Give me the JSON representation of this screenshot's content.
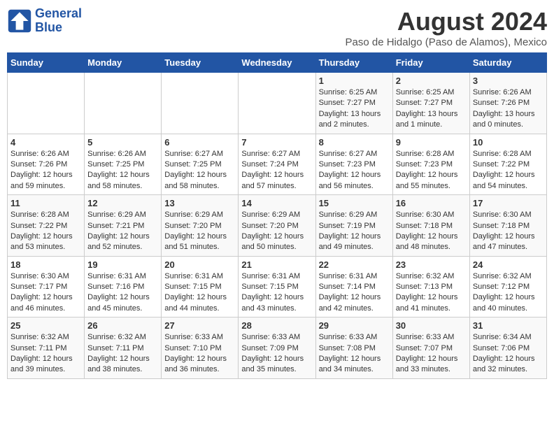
{
  "logo": {
    "line1": "General",
    "line2": "Blue"
  },
  "title": "August 2024",
  "subtitle": "Paso de Hidalgo (Paso de Alamos), Mexico",
  "days_of_week": [
    "Sunday",
    "Monday",
    "Tuesday",
    "Wednesday",
    "Thursday",
    "Friday",
    "Saturday"
  ],
  "weeks": [
    [
      {
        "day": "",
        "info": ""
      },
      {
        "day": "",
        "info": ""
      },
      {
        "day": "",
        "info": ""
      },
      {
        "day": "",
        "info": ""
      },
      {
        "day": "1",
        "info": "Sunrise: 6:25 AM\nSunset: 7:27 PM\nDaylight: 13 hours and 2 minutes."
      },
      {
        "day": "2",
        "info": "Sunrise: 6:25 AM\nSunset: 7:27 PM\nDaylight: 13 hours and 1 minute."
      },
      {
        "day": "3",
        "info": "Sunrise: 6:26 AM\nSunset: 7:26 PM\nDaylight: 13 hours and 0 minutes."
      }
    ],
    [
      {
        "day": "4",
        "info": "Sunrise: 6:26 AM\nSunset: 7:26 PM\nDaylight: 12 hours and 59 minutes."
      },
      {
        "day": "5",
        "info": "Sunrise: 6:26 AM\nSunset: 7:25 PM\nDaylight: 12 hours and 58 minutes."
      },
      {
        "day": "6",
        "info": "Sunrise: 6:27 AM\nSunset: 7:25 PM\nDaylight: 12 hours and 58 minutes."
      },
      {
        "day": "7",
        "info": "Sunrise: 6:27 AM\nSunset: 7:24 PM\nDaylight: 12 hours and 57 minutes."
      },
      {
        "day": "8",
        "info": "Sunrise: 6:27 AM\nSunset: 7:23 PM\nDaylight: 12 hours and 56 minutes."
      },
      {
        "day": "9",
        "info": "Sunrise: 6:28 AM\nSunset: 7:23 PM\nDaylight: 12 hours and 55 minutes."
      },
      {
        "day": "10",
        "info": "Sunrise: 6:28 AM\nSunset: 7:22 PM\nDaylight: 12 hours and 54 minutes."
      }
    ],
    [
      {
        "day": "11",
        "info": "Sunrise: 6:28 AM\nSunset: 7:22 PM\nDaylight: 12 hours and 53 minutes."
      },
      {
        "day": "12",
        "info": "Sunrise: 6:29 AM\nSunset: 7:21 PM\nDaylight: 12 hours and 52 minutes."
      },
      {
        "day": "13",
        "info": "Sunrise: 6:29 AM\nSunset: 7:20 PM\nDaylight: 12 hours and 51 minutes."
      },
      {
        "day": "14",
        "info": "Sunrise: 6:29 AM\nSunset: 7:20 PM\nDaylight: 12 hours and 50 minutes."
      },
      {
        "day": "15",
        "info": "Sunrise: 6:29 AM\nSunset: 7:19 PM\nDaylight: 12 hours and 49 minutes."
      },
      {
        "day": "16",
        "info": "Sunrise: 6:30 AM\nSunset: 7:18 PM\nDaylight: 12 hours and 48 minutes."
      },
      {
        "day": "17",
        "info": "Sunrise: 6:30 AM\nSunset: 7:18 PM\nDaylight: 12 hours and 47 minutes."
      }
    ],
    [
      {
        "day": "18",
        "info": "Sunrise: 6:30 AM\nSunset: 7:17 PM\nDaylight: 12 hours and 46 minutes."
      },
      {
        "day": "19",
        "info": "Sunrise: 6:31 AM\nSunset: 7:16 PM\nDaylight: 12 hours and 45 minutes."
      },
      {
        "day": "20",
        "info": "Sunrise: 6:31 AM\nSunset: 7:15 PM\nDaylight: 12 hours and 44 minutes."
      },
      {
        "day": "21",
        "info": "Sunrise: 6:31 AM\nSunset: 7:15 PM\nDaylight: 12 hours and 43 minutes."
      },
      {
        "day": "22",
        "info": "Sunrise: 6:31 AM\nSunset: 7:14 PM\nDaylight: 12 hours and 42 minutes."
      },
      {
        "day": "23",
        "info": "Sunrise: 6:32 AM\nSunset: 7:13 PM\nDaylight: 12 hours and 41 minutes."
      },
      {
        "day": "24",
        "info": "Sunrise: 6:32 AM\nSunset: 7:12 PM\nDaylight: 12 hours and 40 minutes."
      }
    ],
    [
      {
        "day": "25",
        "info": "Sunrise: 6:32 AM\nSunset: 7:11 PM\nDaylight: 12 hours and 39 minutes."
      },
      {
        "day": "26",
        "info": "Sunrise: 6:32 AM\nSunset: 7:11 PM\nDaylight: 12 hours and 38 minutes."
      },
      {
        "day": "27",
        "info": "Sunrise: 6:33 AM\nSunset: 7:10 PM\nDaylight: 12 hours and 36 minutes."
      },
      {
        "day": "28",
        "info": "Sunrise: 6:33 AM\nSunset: 7:09 PM\nDaylight: 12 hours and 35 minutes."
      },
      {
        "day": "29",
        "info": "Sunrise: 6:33 AM\nSunset: 7:08 PM\nDaylight: 12 hours and 34 minutes."
      },
      {
        "day": "30",
        "info": "Sunrise: 6:33 AM\nSunset: 7:07 PM\nDaylight: 12 hours and 33 minutes."
      },
      {
        "day": "31",
        "info": "Sunrise: 6:34 AM\nSunset: 7:06 PM\nDaylight: 12 hours and 32 minutes."
      }
    ]
  ]
}
